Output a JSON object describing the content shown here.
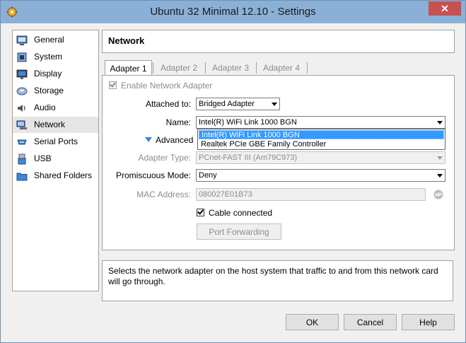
{
  "window": {
    "title": "Ubuntu 32 Minimal 12.10 - Settings",
    "close_label": "✕"
  },
  "sidebar": {
    "items": [
      {
        "label": "General",
        "icon": "general-icon"
      },
      {
        "label": "System",
        "icon": "system-icon"
      },
      {
        "label": "Display",
        "icon": "display-icon"
      },
      {
        "label": "Storage",
        "icon": "storage-icon"
      },
      {
        "label": "Audio",
        "icon": "audio-icon"
      },
      {
        "label": "Network",
        "icon": "network-icon",
        "active": true
      },
      {
        "label": "Serial Ports",
        "icon": "serial-ports-icon"
      },
      {
        "label": "USB",
        "icon": "usb-icon"
      },
      {
        "label": "Shared Folders",
        "icon": "shared-folders-icon"
      }
    ]
  },
  "header": {
    "title": "Network"
  },
  "tabs": [
    "Adapter 1",
    "Adapter 2",
    "Adapter 3",
    "Adapter 4"
  ],
  "form": {
    "enable_label": "Enable Network Adapter",
    "attached_label": "Attached to:",
    "attached_value": "Bridged Adapter",
    "name_label": "Name:",
    "name_value": "Intel(R) WiFi Link 1000 BGN",
    "advanced_label": "Advanced",
    "adapter_type_label": "Adapter Type:",
    "adapter_type_value": "PCnet-FAST III (Am79C973)",
    "promiscuous_label": "Promiscuous Mode:",
    "promiscuous_value": "Deny",
    "mac_label": "MAC Address:",
    "mac_value": "080027E01B73",
    "cable_label": "Cable connected",
    "port_forwarding_label": "Port Forwarding"
  },
  "name_dropdown": {
    "options": [
      "Intel(R) WiFi Link 1000 BGN",
      "Realtek PCIe GBE Family Controller"
    ]
  },
  "description": "Selects the network adapter on the host system that traffic to and from this network card will go through.",
  "buttons": {
    "ok": "OK",
    "cancel": "Cancel",
    "help": "Help"
  },
  "colors": {
    "titlebar": "#8ab0d8",
    "close": "#c75050",
    "selection": "#3399ff"
  }
}
